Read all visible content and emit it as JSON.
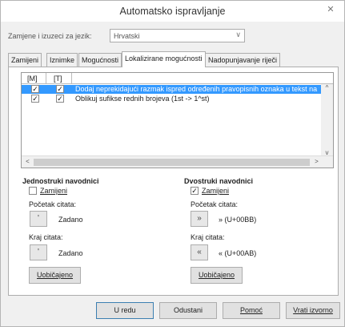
{
  "window": {
    "title": "Automatsko ispravljanje",
    "close_glyph": "✕"
  },
  "language": {
    "label": "Zamjene i izuzeci za jezik:",
    "selected": "Hrvatski",
    "chevron_glyph": "∨"
  },
  "tabs": [
    {
      "label": "Zamijeni",
      "active": false
    },
    {
      "label": "Iznimke",
      "active": false
    },
    {
      "label": "Mogućnosti",
      "active": false
    },
    {
      "label": "Lokalizirane mogućnosti",
      "active": true
    },
    {
      "label": "Nadopunjavanje riječi",
      "active": false
    }
  ],
  "options_list": {
    "columns": [
      "[M]",
      "[T]"
    ],
    "rows": [
      {
        "m_checked": true,
        "t_checked": true,
        "text": "Dodaj neprekidajući razmak ispred određenih pravopisnih oznaka u tekst na fra",
        "selected": true
      },
      {
        "m_checked": true,
        "t_checked": true,
        "text": "Oblikuj sufikse rednih brojeva (1st -> 1^st)",
        "selected": false
      }
    ],
    "check_glyph": "✓",
    "scroll_up_glyph": "^",
    "scroll_down_glyph": "v",
    "scroll_left_glyph": "<",
    "scroll_right_glyph": ">"
  },
  "single_quotes": {
    "title": "Jednostruki navodnici",
    "replace_label": "Zamijeni",
    "replace_checked": false,
    "start_label": "Početak citata:",
    "start_glyph": "'",
    "start_value": "Zadano",
    "end_label": "Kraj citata:",
    "end_glyph": "'",
    "end_value": "Zadano",
    "default_button": "Uobičajeno"
  },
  "double_quotes": {
    "title": "Dvostruki navodnici",
    "replace_label": "Zamijeni",
    "replace_checked": true,
    "start_label": "Početak citata:",
    "start_glyph": "»",
    "start_value": "» (U+00BB)",
    "end_label": "Kraj citata:",
    "end_glyph": "«",
    "end_value": "« (U+00AB)",
    "default_button": "Uobičajeno"
  },
  "footer": {
    "ok": "U redu",
    "cancel": "Odustani",
    "help": "Pomoć",
    "reset": "Vrati izvorno"
  }
}
